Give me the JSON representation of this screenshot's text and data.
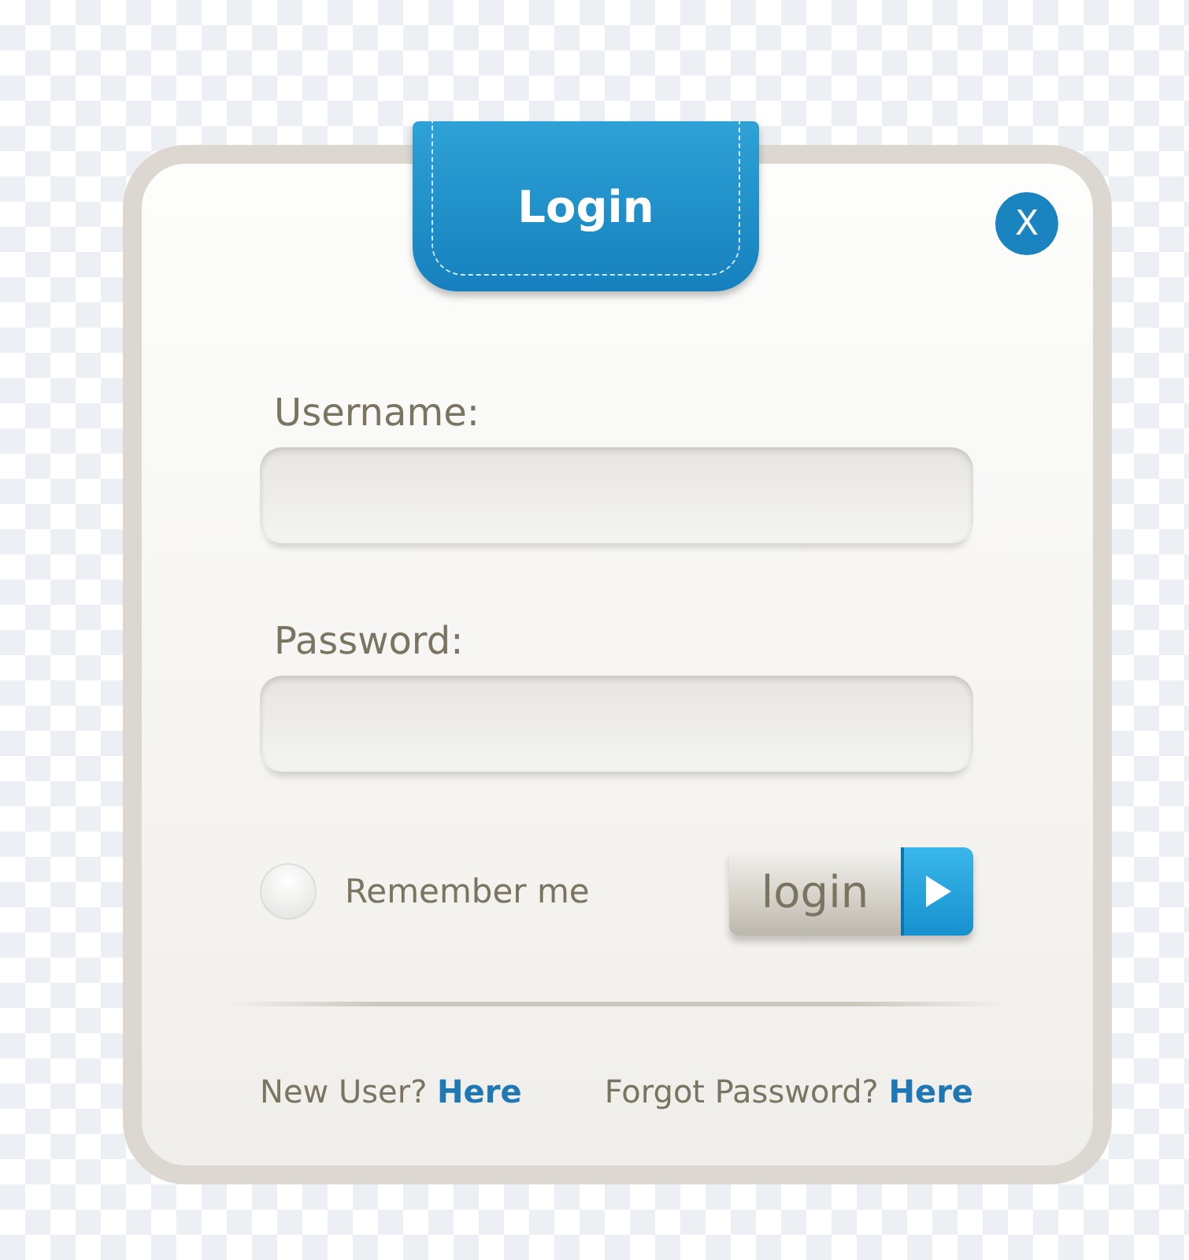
{
  "title_tab": "Login",
  "close_button": "X",
  "fields": [
    {
      "label": "Username:"
    },
    {
      "label": "Password:"
    }
  ],
  "remember": {
    "label": "Remember me",
    "checked": false
  },
  "submit_button": "login",
  "footer": [
    {
      "text": "New User?",
      "link": "Here"
    },
    {
      "text": "Forgot Password?",
      "link": "Here"
    }
  ]
}
